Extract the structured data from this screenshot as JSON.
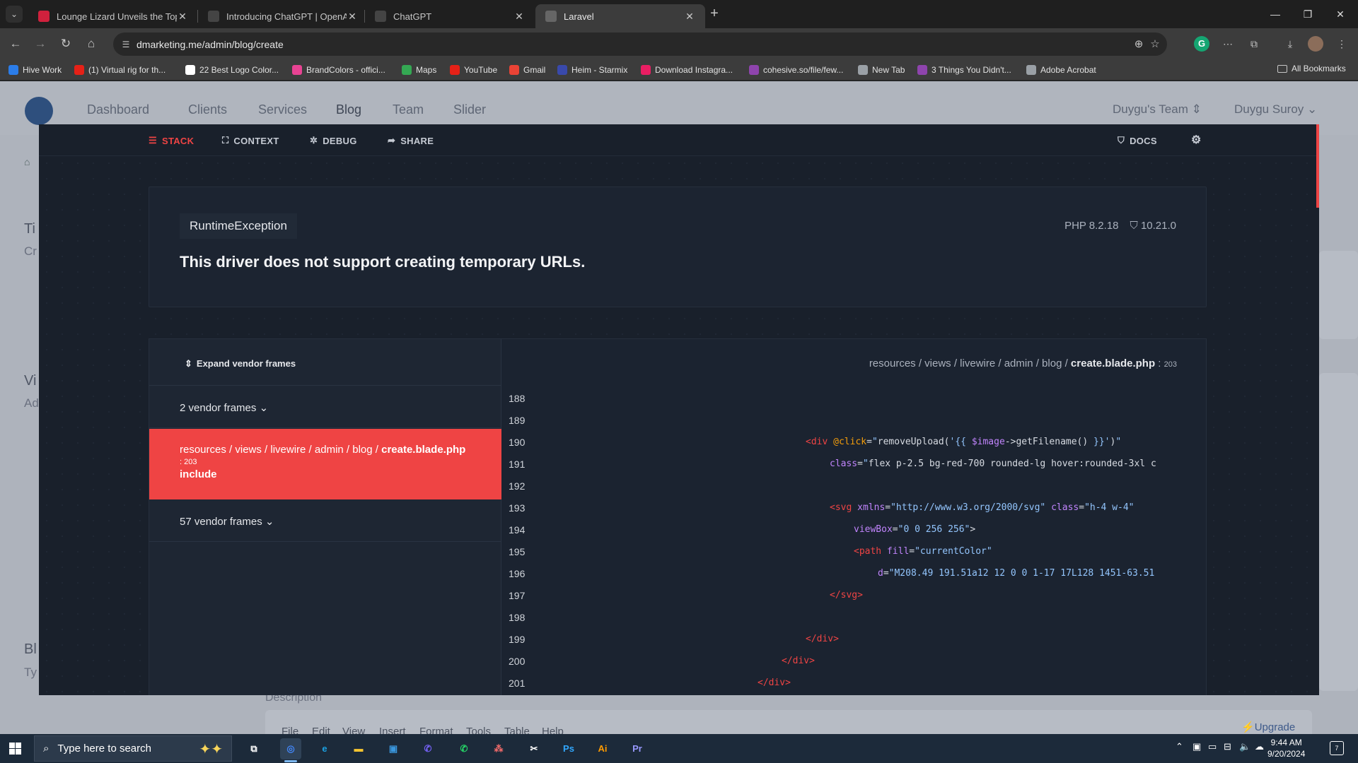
{
  "browser": {
    "tabs": [
      {
        "title": "Lounge Lizard Unveils the Top I",
        "favicon": "LL",
        "favicon_color": "#d0213d"
      },
      {
        "title": "Introducing ChatGPT | OpenAI",
        "favicon": "AI",
        "favicon_color": "#444"
      },
      {
        "title": "ChatGPT",
        "favicon": "AI",
        "favicon_color": "#444"
      },
      {
        "title": "Laravel",
        "favicon": "L",
        "favicon_color": "#666"
      }
    ],
    "active_tab": 3,
    "url": "dmarketing.me/admin/blog/create",
    "bookmarks": [
      {
        "label": "Hive Work",
        "color": "#2b7de9"
      },
      {
        "label": "(1) Virtual rig for th...",
        "color": "#e62117"
      },
      {
        "label": "22 Best Logo Color...",
        "color": "#ffffff"
      },
      {
        "label": "BrandColors - offici...",
        "color": "#e84393"
      },
      {
        "label": "Maps",
        "color": "#34a853"
      },
      {
        "label": "YouTube",
        "color": "#e62117"
      },
      {
        "label": "Gmail",
        "color": "#ea4335"
      },
      {
        "label": "Heim - Starmix",
        "color": "#3949ab"
      },
      {
        "label": "Download Instagra...",
        "color": "#e91e63"
      },
      {
        "label": "cohesive.so/file/few...",
        "color": "#8e44ad"
      },
      {
        "label": "New Tab",
        "color": "#9aa0a6"
      },
      {
        "label": "3 Things You Didn't...",
        "color": "#8e44ad"
      },
      {
        "label": "Adobe Acrobat",
        "color": "#9aa0a6"
      }
    ],
    "all_bookmarks": "All Bookmarks"
  },
  "app": {
    "nav": [
      "Dashboard",
      "Clients",
      "Services",
      "Blog",
      "Team",
      "Slider"
    ],
    "team": "Duygu's Team",
    "user": "Duygu Suroy",
    "bg": {
      "title_fragment": "Ti",
      "sub_fragment": "Cr",
      "vi_fragment": "Vi",
      "ad_fragment": "Ad",
      "bl_fragment": "Bl",
      "ty_fragment": "Ty",
      "description": "Description",
      "editor_menu": [
        "File",
        "Edit",
        "View",
        "Insert",
        "Format",
        "Tools",
        "Table",
        "Help"
      ],
      "upgrade": "Upgrade"
    }
  },
  "ignition": {
    "tabs": {
      "stack": "STACK",
      "context": "CONTEXT",
      "debug": "DEBUG",
      "share": "SHARE",
      "docs": "DOCS"
    },
    "exception_type": "RuntimeException",
    "message": "This driver does not support creating temporary URLs.",
    "php_version": "PHP 8.2.18",
    "laravel_version": "10.21.0",
    "expand_vendor": "Expand vendor frames",
    "vendor_frames_top": "2 vendor frames",
    "vendor_frames_bottom": "57 vendor frames",
    "active_frame": {
      "path": "resources / views / livewire / admin / blog / ",
      "file": "create.blade.php",
      "line": ": 203",
      "function": "include"
    },
    "code_file": {
      "path": "resources / views / livewire / admin / blog / ",
      "file": "create.blade.php",
      "line": "203"
    },
    "code_lines": [
      {
        "n": "188",
        "indent": 0,
        "html": ""
      },
      {
        "n": "189",
        "indent": 0,
        "html": ""
      },
      {
        "n": "190",
        "indent": 360,
        "html": "<span class='tg'>&lt;div</span> <span class='ev'>@click</span>=<span class='st'>\"</span>removeUpload(<span class='st'>'{{</span> <span class='at'>$image</span>-&gt;getFilename() <span class='st'>}}'</span>)<span class='st'>\"</span>"
      },
      {
        "n": "191",
        "indent": 394,
        "html": "<span class='at'>class</span>=<span class='st'>\"</span>flex p-2.5 bg-red-700 rounded-lg hover:rounded-3xl c"
      },
      {
        "n": "192",
        "indent": 0,
        "html": ""
      },
      {
        "n": "193",
        "indent": 394,
        "html": "<span class='tg'>&lt;svg</span> <span class='at'>xmlns</span>=<span class='st'>\"http://www.w3.org/2000/svg\"</span> <span class='at'>class</span>=<span class='st'>\"h-4 w-4\"</span>"
      },
      {
        "n": "194",
        "indent": 428,
        "html": "<span class='at'>viewBox</span>=<span class='st'>\"0 0 256 256\"</span>&gt;"
      },
      {
        "n": "195",
        "indent": 428,
        "html": "<span class='tg'>&lt;path</span> <span class='at'>fill</span>=<span class='st'>\"currentColor\"</span>"
      },
      {
        "n": "196",
        "indent": 462,
        "html": "<span class='at'>d</span>=<span class='st'>\"M208.49 191.51a12 12 0 0 1-17 17L128 1451-63.51</span>"
      },
      {
        "n": "197",
        "indent": 394,
        "html": "<span class='tg'>&lt;/svg&gt;</span>"
      },
      {
        "n": "198",
        "indent": 0,
        "html": ""
      },
      {
        "n": "199",
        "indent": 360,
        "html": "<span class='tg'>&lt;/div&gt;</span>"
      },
      {
        "n": "200",
        "indent": 326,
        "html": "<span class='tg'>&lt;/div&gt;</span>"
      },
      {
        "n": "201",
        "indent": 292,
        "html": "<span class='tg'>&lt;/div&gt;</span>"
      }
    ]
  },
  "taskbar": {
    "search_placeholder": "Type here to search",
    "time": "9:44 AM",
    "date": "9/20/2024",
    "apps": [
      {
        "name": "task-view-icon",
        "label": "⧉",
        "color": "#ffffff"
      },
      {
        "name": "chrome-icon",
        "label": "◎",
        "color": "#4285f4"
      },
      {
        "name": "edge-icon",
        "label": "e",
        "color": "#1ba1e2"
      },
      {
        "name": "file-explorer-icon",
        "label": "▬",
        "color": "#f4c430"
      },
      {
        "name": "store-icon",
        "label": "▣",
        "color": "#3a96dd"
      },
      {
        "name": "viber-icon",
        "label": "✆",
        "color": "#7360f2"
      },
      {
        "name": "whatsapp-icon",
        "label": "✆",
        "color": "#25d366"
      },
      {
        "name": "asana-icon",
        "label": "⁂",
        "color": "#f06a6a"
      },
      {
        "name": "capcut-icon",
        "label": "✂",
        "color": "#ffffff"
      },
      {
        "name": "photoshop-icon",
        "label": "Ps",
        "color": "#31a8ff"
      },
      {
        "name": "illustrator-icon",
        "label": "Ai",
        "color": "#ff9a00"
      },
      {
        "name": "premiere-icon",
        "label": "Pr",
        "color": "#9999ff"
      }
    ]
  }
}
